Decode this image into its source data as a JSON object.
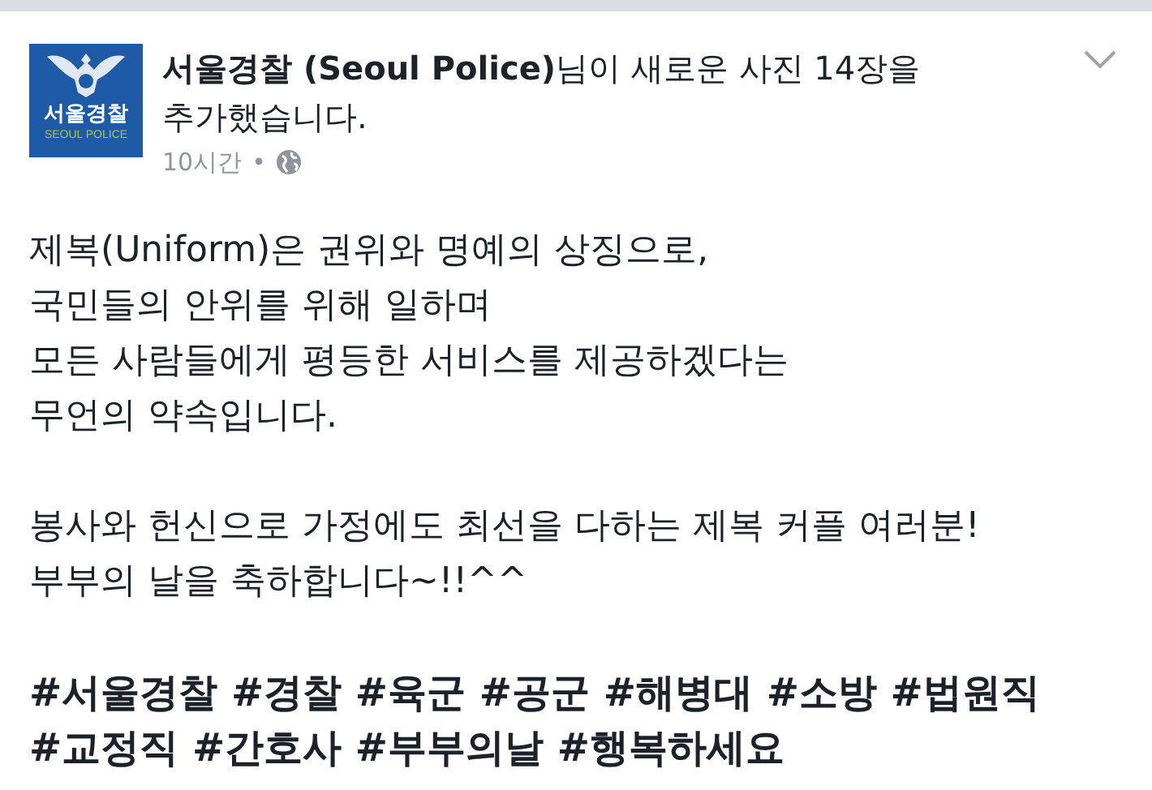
{
  "post": {
    "logo": {
      "name_text": "서울경찰",
      "subtitle": "SEOUL POLICE"
    },
    "headline": "**서울경찰 (Seoul Police)**님이 새로운 사진 14장을\n추가했습니다.",
    "time": "10시간",
    "separator": "•",
    "paragraphs": [
      "제복(Uniform)은 권위와 명예의 상징으로,\n국민들의 안위를 위해 일하며\n모든 사람들에게 평등한 서비스를 제공하겠다는\n무언의 약속입니다.",
      "봉사와 헌신으로 가정에도 최선을 다하는 제복 커플 여러분!\n부부의 날을 축하합니다~!!^^"
    ],
    "hashtags": "#서울경찰 #경찰 #육군 #공군 #해병대 #소방 #법원직\n#교정직 #간호사 #부부의날 #행복하세요"
  }
}
